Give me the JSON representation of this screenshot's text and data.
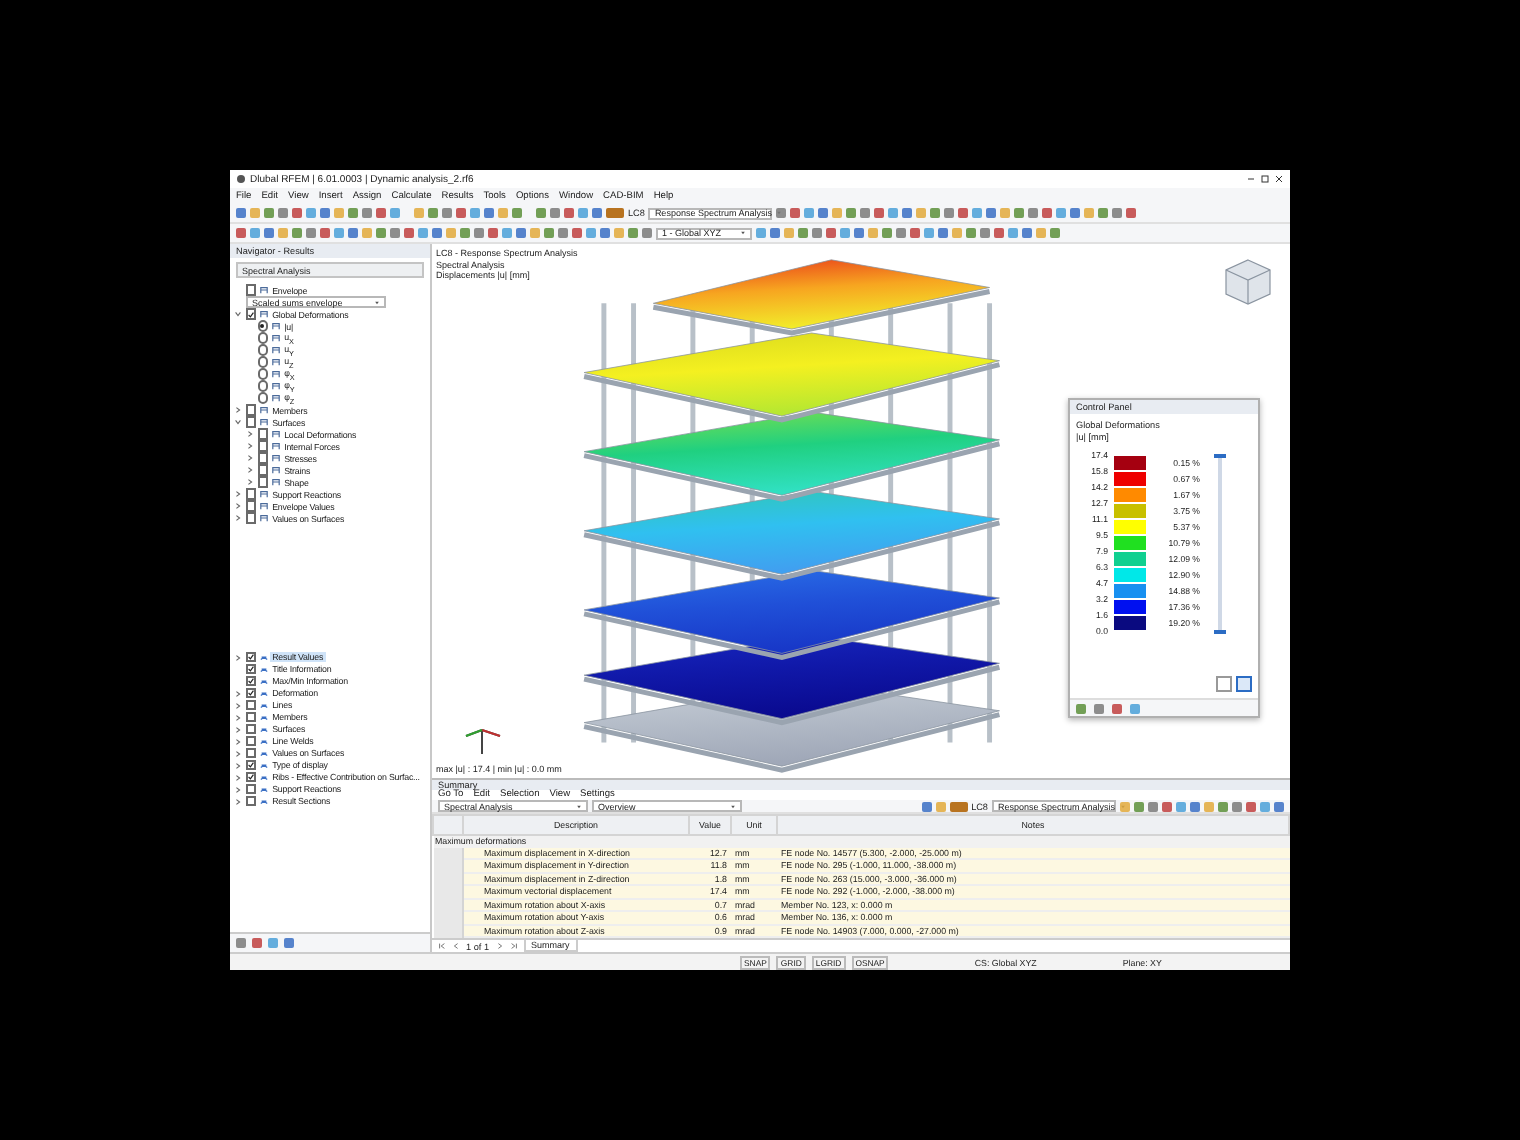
{
  "window": {
    "title": "Dlubal RFEM | 6.01.0003 | Dynamic analysis_2.rf6"
  },
  "menu": [
    "File",
    "Edit",
    "View",
    "Insert",
    "Assign",
    "Calculate",
    "Results",
    "Tools",
    "Options",
    "Window",
    "CAD-BIM",
    "Help"
  ],
  "toolbar": {
    "load_case": "LC8",
    "load_case_name": "Response Spectrum Analysis",
    "coordinate_system": "1 - Global XYZ"
  },
  "navigator": {
    "title": "Navigator - Results",
    "analysis": "Spectral Analysis",
    "tree": [
      {
        "kind": "checkbox",
        "label": "Envelope",
        "checked": false
      },
      {
        "kind": "combo",
        "label": "Scaled sums envelope"
      },
      {
        "kind": "checkbox",
        "label": "Global Deformations",
        "checked": true,
        "expanded": true,
        "children": [
          {
            "kind": "radio",
            "label": "|u|",
            "selected": true
          },
          {
            "kind": "radio",
            "label": "u$_{X}$",
            "selected": false
          },
          {
            "kind": "radio",
            "label": "u$_{Y}$",
            "selected": false
          },
          {
            "kind": "radio",
            "label": "u$_{Z}$",
            "selected": false
          },
          {
            "kind": "radio",
            "label": "φ$_{X}$",
            "selected": false
          },
          {
            "kind": "radio",
            "label": "φ$_{Y}$",
            "selected": false
          },
          {
            "kind": "radio",
            "label": "φ$_{Z}$",
            "selected": false
          }
        ]
      },
      {
        "kind": "checkbox",
        "label": "Members",
        "checked": false,
        "expanded": false
      },
      {
        "kind": "checkbox",
        "label": "Surfaces",
        "checked": false,
        "expanded": true,
        "children": [
          {
            "kind": "checkbox",
            "label": "Local Deformations",
            "checked": false,
            "expanded": false
          },
          {
            "kind": "checkbox",
            "label": "Internal Forces",
            "checked": false,
            "expanded": false
          },
          {
            "kind": "checkbox",
            "label": "Stresses",
            "checked": false,
            "expanded": false
          },
          {
            "kind": "checkbox",
            "label": "Strains",
            "checked": false,
            "expanded": false
          },
          {
            "kind": "checkbox",
            "label": "Shape",
            "checked": false,
            "expanded": false
          }
        ]
      },
      {
        "kind": "checkbox",
        "label": "Support Reactions",
        "checked": false,
        "expanded": false
      },
      {
        "kind": "checkbox",
        "label": "Envelope Values",
        "checked": false,
        "expanded": false
      },
      {
        "kind": "checkbox",
        "label": "Values on Surfaces",
        "checked": false,
        "expanded": false
      }
    ],
    "display_tree": [
      {
        "kind": "checkbox",
        "label": "Result Values",
        "checked": true,
        "expanded": false,
        "selected": true
      },
      {
        "kind": "checkbox",
        "label": "Title Information",
        "checked": true,
        "selected": false
      },
      {
        "kind": "checkbox",
        "label": "Max/Min Information",
        "checked": true,
        "selected": false
      },
      {
        "kind": "checkbox",
        "label": "Deformation",
        "checked": true,
        "expanded": false,
        "selected": false
      },
      {
        "kind": "checkbox",
        "label": "Lines",
        "checked": false,
        "expanded": false,
        "selected": false
      },
      {
        "kind": "checkbox",
        "label": "Members",
        "checked": false,
        "expanded": false,
        "selected": false
      },
      {
        "kind": "checkbox",
        "label": "Surfaces",
        "checked": false,
        "expanded": false,
        "selected": false
      },
      {
        "kind": "checkbox",
        "label": "Line Welds",
        "checked": false,
        "expanded": false,
        "selected": false
      },
      {
        "kind": "checkbox",
        "label": "Values on Surfaces",
        "checked": false,
        "expanded": false,
        "selected": false
      },
      {
        "kind": "checkbox",
        "label": "Type of display",
        "checked": true,
        "expanded": false,
        "selected": false
      },
      {
        "kind": "checkbox",
        "label": "Ribs - Effective Contribution on Surfac...",
        "checked": true,
        "expanded": false,
        "selected": false
      },
      {
        "kind": "checkbox",
        "label": "Support Reactions",
        "checked": false,
        "expanded": false,
        "selected": false
      },
      {
        "kind": "checkbox",
        "label": "Result Sections",
        "checked": false,
        "expanded": false,
        "selected": false
      }
    ]
  },
  "viewport": {
    "header": [
      "LC8 - Response Spectrum Analysis",
      "Spectral Analysis",
      "Displacements |u| [mm]"
    ],
    "footer": "max |u| : 17.4 | min |u| : 0.0 mm"
  },
  "control_panel": {
    "title": "Control Panel",
    "heading": "Global Deformations",
    "unit": "|u| [mm]",
    "values": [
      "17.4",
      "15.8",
      "14.2",
      "12.7",
      "11.1",
      "9.5",
      "7.9",
      "6.3",
      "4.7",
      "3.2",
      "1.6",
      "0.0"
    ],
    "slider_thumbs": [
      {
        "level": 1
      },
      {
        "level": 0
      }
    ],
    "bands": [
      {
        "color": "#a50010",
        "share": "0.15 %"
      },
      {
        "color": "#ee0000",
        "share": "0.67 %"
      },
      {
        "color": "#ff8a00",
        "share": "1.67 %"
      },
      {
        "color": "#c8c000",
        "share": "3.75 %"
      },
      {
        "color": "#ffff00",
        "share": "5.37 %"
      },
      {
        "color": "#20e020",
        "share": "10.79 %"
      },
      {
        "color": "#10d090",
        "share": "12.09 %"
      },
      {
        "color": "#00e8e8",
        "share": "12.90 %"
      },
      {
        "color": "#1890f0",
        "share": "14.88 %"
      },
      {
        "color": "#0010f0",
        "share": "17.36 %"
      },
      {
        "color": "#0a0a80",
        "share": "19.20 %"
      }
    ]
  },
  "summary": {
    "title": "Summary",
    "menu": [
      "Go To",
      "Edit",
      "Selection",
      "View",
      "Settings"
    ],
    "analysis": "Spectral Analysis",
    "view": "Overview",
    "load_case": "LC8",
    "load_case_name": "Response Spectrum Analysis",
    "columns": [
      "Description",
      "Value",
      "Unit",
      "Notes"
    ],
    "group": "Maximum deformations",
    "rows": [
      [
        "Maximum displacement in X-direction",
        "12.7",
        "mm",
        "FE node No. 14577 (5.300, -2.000, -25.000 m)"
      ],
      [
        "Maximum displacement in Y-direction",
        "11.8",
        "mm",
        "FE node No. 295 (-1.000, 11.000, -38.000 m)"
      ],
      [
        "Maximum displacement in Z-direction",
        "1.8",
        "mm",
        "FE node No. 263 (15.000, -3.000, -36.000 m)"
      ],
      [
        "Maximum vectorial displacement",
        "17.4",
        "mm",
        "FE node No. 292 (-1.000, -2.000, -38.000 m)"
      ],
      [
        "Maximum rotation about X-axis",
        "0.7",
        "mrad",
        "Member No. 123, x: 0.000 m"
      ],
      [
        "Maximum rotation about Y-axis",
        "0.6",
        "mrad",
        "Member No. 136, x: 0.000 m"
      ],
      [
        "Maximum rotation about Z-axis",
        "0.9",
        "mrad",
        "FE node No. 14903 (7.000, 0.000, -27.000 m)"
      ]
    ],
    "pager": "1 of 1",
    "tabs": [
      {
        "label": "Summary",
        "selected": true
      }
    ]
  },
  "status_bar": {
    "toggles": [
      "SNAP",
      "GRID",
      "LGRID",
      "OSNAP"
    ],
    "coordinate_system": "CS: Global XYZ",
    "plane": "Plane: XY"
  }
}
